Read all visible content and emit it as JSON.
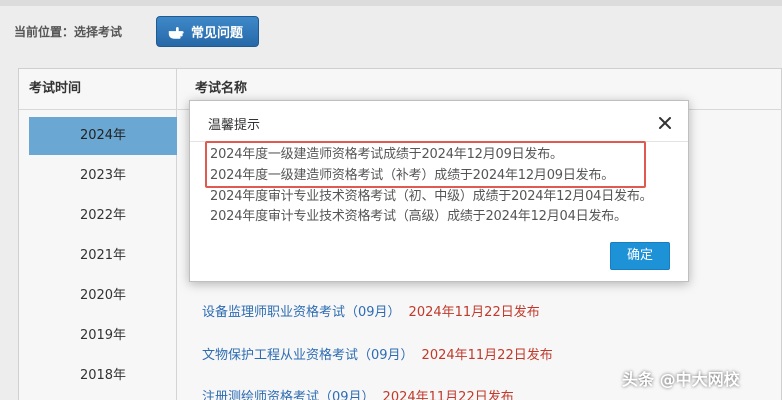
{
  "header": {
    "breadcrumb": "当前位置：选择考试",
    "faq_button": "常见问题"
  },
  "table": {
    "col_year": "考试时间",
    "col_name": "考试名称",
    "years": [
      "2024年",
      "2023年",
      "2022年",
      "2021年",
      "2020年",
      "2019年",
      "2018年"
    ],
    "selected_year": "2024年",
    "exams": [
      {
        "name": "设备监理师职业资格考试（09月）",
        "date": "2024年11月22日发布"
      },
      {
        "name": "文物保护工程从业资格考试（09月）",
        "date": "2024年11月22日发布"
      },
      {
        "name": "注册测绘师资格考试（09月）",
        "date": "2024年11月22日发布"
      }
    ]
  },
  "modal": {
    "title": "温馨提示",
    "notices": [
      "2024年度一级建造师资格考试成绩于2024年12月09日发布。",
      "2024年度一级建造师资格考试（补考）成绩于2024年12月09日发布。",
      "2024年度审计专业技术资格考试（初、中级）成绩于2024年12月04日发布。",
      "2024年度审计专业技术资格考试（高级）成绩于2024年12月04日发布。"
    ],
    "confirm_label": "确定",
    "highlight_color": "#e05b4f"
  },
  "watermark": "头条 @中大网校",
  "colors": {
    "accent": "#1e92d6",
    "active_year": "#6aa8d3",
    "link": "#2d6cb3",
    "date_red": "#c0392b"
  }
}
